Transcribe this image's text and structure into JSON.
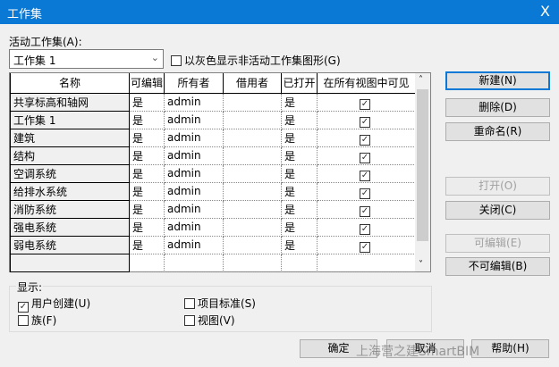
{
  "window": {
    "title": "工作集",
    "close": "X"
  },
  "active_label": "活动工作集(A):",
  "active_value": "工作集 1",
  "gray_checkbox": {
    "label": "以灰色显示非活动工作集图形(G)",
    "checked": false
  },
  "table": {
    "headers": [
      "名称",
      "可编辑",
      "所有者",
      "借用者",
      "已打开",
      "在所有视图中可见"
    ],
    "rows": [
      {
        "name": "共享标高和轴网",
        "editable": "是",
        "owner": "admin",
        "borrower": "",
        "opened": "是",
        "visible": true
      },
      {
        "name": "工作集 1",
        "editable": "是",
        "owner": "admin",
        "borrower": "",
        "opened": "是",
        "visible": true
      },
      {
        "name": "建筑",
        "editable": "是",
        "owner": "admin",
        "borrower": "",
        "opened": "是",
        "visible": true
      },
      {
        "name": "结构",
        "editable": "是",
        "owner": "admin",
        "borrower": "",
        "opened": "是",
        "visible": true
      },
      {
        "name": "空调系统",
        "editable": "是",
        "owner": "admin",
        "borrower": "",
        "opened": "是",
        "visible": true
      },
      {
        "name": "给排水系统",
        "editable": "是",
        "owner": "admin",
        "borrower": "",
        "opened": "是",
        "visible": true
      },
      {
        "name": "消防系统",
        "editable": "是",
        "owner": "admin",
        "borrower": "",
        "opened": "是",
        "visible": true
      },
      {
        "name": "强电系统",
        "editable": "是",
        "owner": "admin",
        "borrower": "",
        "opened": "是",
        "visible": true
      },
      {
        "name": "弱电系统",
        "editable": "是",
        "owner": "admin",
        "borrower": "",
        "opened": "是",
        "visible": true
      }
    ]
  },
  "buttons": {
    "new": "新建(N)",
    "delete": "删除(D)",
    "rename": "重命名(R)",
    "open": "打开(O)",
    "close": "关闭(C)",
    "editable": "可编辑(E)",
    "noneditable": "不可编辑(B)"
  },
  "display": {
    "label": "显示:",
    "user_created": {
      "label": "用户创建(U)",
      "checked": true
    },
    "families": {
      "label": "族(F)",
      "checked": false
    },
    "project_standards": {
      "label": "项目标准(S)",
      "checked": false
    },
    "views": {
      "label": "视图(V)",
      "checked": false
    }
  },
  "footer": {
    "ok": "确定",
    "cancel": "取消",
    "help": "帮助(H)"
  },
  "watermark": "上海营之建SmartBIM"
}
